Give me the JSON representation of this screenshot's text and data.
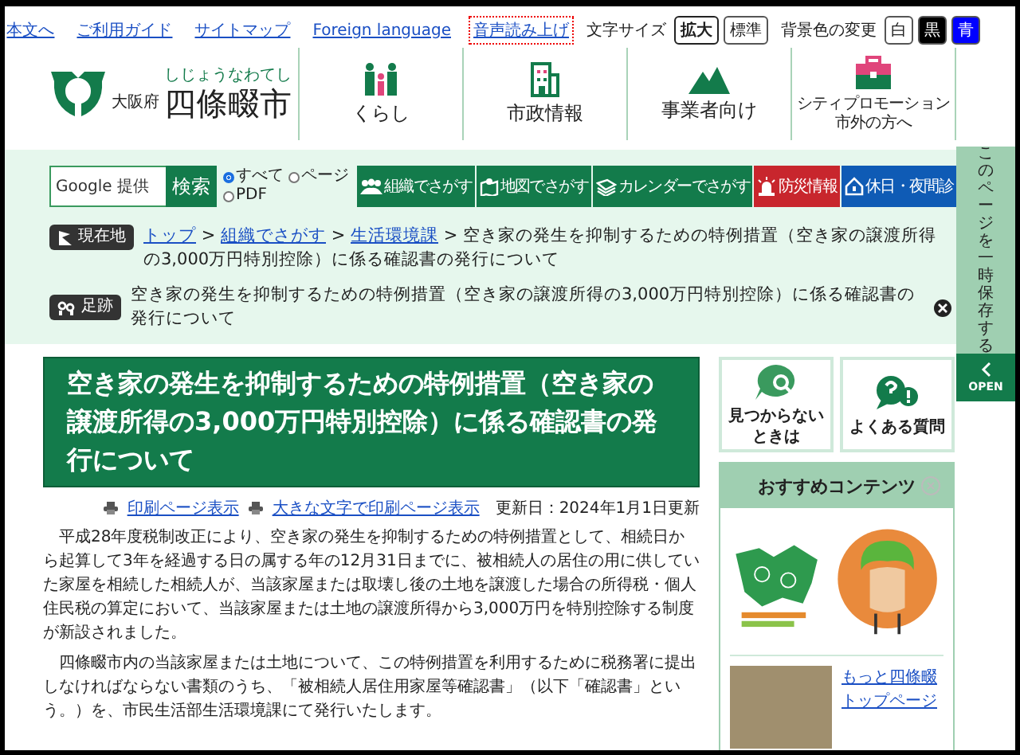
{
  "top_links": [
    {
      "label": "本文へ",
      "focused": false
    },
    {
      "label": "ご利用ガイド",
      "focused": false
    },
    {
      "label": "サイトマップ",
      "focused": false
    },
    {
      "label": "Foreign language",
      "focused": false
    },
    {
      "label": "音声読み上げ",
      "focused": true
    }
  ],
  "text_size": {
    "label": "文字サイズ",
    "options": [
      {
        "label": "拡大",
        "selected": true
      },
      {
        "label": "標準",
        "selected": false
      }
    ]
  },
  "background_color": {
    "label": "背景色の変更",
    "options": [
      {
        "label": "白",
        "color": "#ffffff"
      },
      {
        "label": "黒",
        "color": "#000000"
      },
      {
        "label": "青",
        "color": "#0000ff"
      }
    ]
  },
  "logo": {
    "prefecture": "大阪府",
    "reading": "しじょうなわてし",
    "city": "四條畷市"
  },
  "nav": [
    {
      "kind": "people",
      "lines": [
        "くらし"
      ]
    },
    {
      "kind": "building",
      "lines": [
        "市政情報"
      ]
    },
    {
      "kind": "mountain",
      "lines": [
        "事業者向け"
      ]
    },
    {
      "kind": "briefcase",
      "lines": [
        "シティプロモーション",
        "市外の方へ"
      ]
    }
  ],
  "search": {
    "placeholder": "Google 提供",
    "button": "検索",
    "scopes": [
      {
        "label": "すべて",
        "selected": true
      },
      {
        "label": "ページ",
        "selected": false
      },
      {
        "label": "PDF",
        "selected": false
      }
    ]
  },
  "quick_links": [
    {
      "kind": "people",
      "label": "組織でさがす",
      "color": "#137b4b"
    },
    {
      "kind": "map",
      "label": "地図でさがす",
      "color": "#137b4b"
    },
    {
      "kind": "calendar",
      "label": "カレンダーでさがす",
      "color": "#137b4b"
    },
    {
      "kind": "alarm",
      "label": "防災情報",
      "color": "#c8262d"
    },
    {
      "kind": "house",
      "label": "休日・夜間診",
      "color": "#0f5bb5"
    }
  ],
  "breadcrumb": {
    "label": "現在地",
    "separator": ">",
    "links": [
      "トップ",
      "組織でさがす",
      "生活環境課"
    ],
    "current": "空き家の発生を抑制するための特例措置（空き家の譲渡所得の3,000万円特別控除）に係る確認書の発行について"
  },
  "footprint": {
    "label": "足跡",
    "text": "空き家の発生を抑制するための特例措置（空き家の譲渡所得の3,000万円特別控除）に係る確認書の発行について"
  },
  "save_tab": {
    "label": "このページを一時保存する",
    "open": "OPEN"
  },
  "page_title": "空き家の発生を抑制するための特例措置（空き家の譲渡所得の3,000万円特別控除）に係る確認書の発行について",
  "print_links": [
    "印刷ページ表示",
    "大きな文字で印刷ページ表示"
  ],
  "updated": "更新日：2024年1月1日更新",
  "paragraphs": [
    "平成28年度税制改正により、空き家の発生を抑制するための特例措置として、相続日から起算して3年を経過する日の属する年の12月31日までに、被相続人の居住の用に供していた家屋を相続した相続人が、当該家屋または取壊し後の土地を譲渡した場合の所得税・個人住民税の算定において、当該家屋または土地の譲渡所得から3,000万円を特別控除する制度が新設されました。",
    "四條畷市内の当該家屋または土地について、この特例措置を利用するために税務署に提出しなければならない書類のうち、「被相続人居住用家屋等確認書」（以下「確認書」という。）を、市民生活部生活環境課にて発行いたします。"
  ],
  "help_buttons": [
    {
      "kind": "search",
      "lines": [
        "見つからない",
        "ときは"
      ]
    },
    {
      "kind": "faq",
      "lines": [
        "よくある質問"
      ]
    }
  ],
  "recommended": {
    "title": "おすすめコンテンツ",
    "link": "もっと四條畷トップページ"
  }
}
